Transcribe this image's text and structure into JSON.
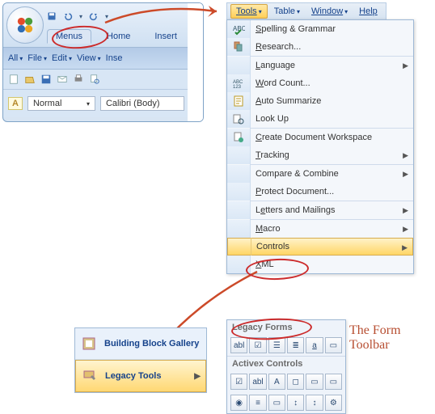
{
  "ribbon": {
    "tabs": {
      "menus": "Menus",
      "home": "Home",
      "insert": "Insert"
    },
    "menus_row": {
      "all": "All",
      "file": "File",
      "edit": "Edit",
      "view": "View",
      "inse": "Inse"
    },
    "style_label": "A",
    "style_value": "Normal",
    "font_value": "Calibri (Body)"
  },
  "menubar": {
    "tools": "Tools",
    "table": "Table",
    "window": "Window",
    "help": "Help"
  },
  "tools_menu": {
    "spelling": "Spelling & Grammar",
    "research": "Research...",
    "language": "Language",
    "wordcount": "Word Count...",
    "autosum": "Auto Summarize",
    "lookup": "Look Up",
    "cdw": "Create Document Workspace",
    "tracking": "Tracking",
    "compare": "Compare & Combine",
    "protect": "Protect Document...",
    "lettersmail": "Letters and Mailings",
    "macro": "Macro",
    "controls": "Controls",
    "xml": "XML"
  },
  "bottom": {
    "bbgallery": "Building Block Gallery",
    "legacytools": "Legacy Tools",
    "legacyforms": "Legacy Forms",
    "activex": "Activex Controls"
  },
  "annotation": "The Form Toolbar",
  "icons": {
    "abl": "abl",
    "chk": "☑",
    "dd": "☰",
    "txt": "≣",
    "a": "a",
    "pg": "▭",
    "A": "A",
    "sq": "◻",
    "rb": "◉",
    "sc": "↕",
    "img": "▭",
    "hm": "≡",
    "wr": "⚙"
  }
}
